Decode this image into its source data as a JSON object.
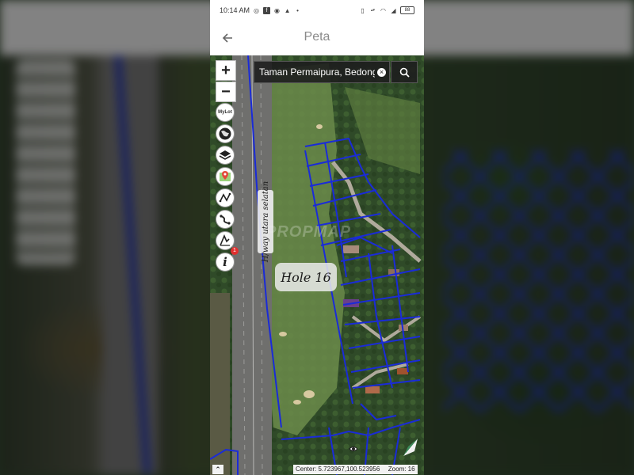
{
  "status_bar": {
    "time": "10:14 AM",
    "battery": "88",
    "icons": [
      "whatsapp-icon",
      "facebook-icon",
      "messenger-icon",
      "warning-icon",
      "dot-icon",
      "vibrate-icon",
      "data-speed-icon",
      "wifi-icon",
      "signal-icon",
      "battery-icon"
    ]
  },
  "app_bar": {
    "title": "Peta",
    "back_icon": "back-arrow-icon"
  },
  "map": {
    "search": {
      "value": "Taman Permaipura, Bedong",
      "placeholder": ""
    },
    "zoom_in_label": "+",
    "zoom_out_label": "−",
    "tools": [
      {
        "name": "mylot-button",
        "label": "MyLot"
      },
      {
        "name": "globe-button",
        "icon": "globe-icon"
      },
      {
        "name": "layers-button",
        "icon": "layers-icon"
      },
      {
        "name": "location-button",
        "icon": "map-pin-icon"
      },
      {
        "name": "measure-button",
        "icon": "measure-icon"
      },
      {
        "name": "route-button",
        "icon": "route-icon"
      },
      {
        "name": "draw-button",
        "icon": "pen-icon"
      },
      {
        "name": "info-button",
        "label": "i"
      }
    ],
    "info_badge": "1",
    "road_label": "H/way utara selatan",
    "hole_label": "Hole 16",
    "watermark": "PROPMAP",
    "center_label": "Center: 5.723967,100.523956",
    "zoom_label": "Zoom: 16",
    "collapse_icon": "caret-up-icon"
  },
  "colors": {
    "boundary": "#1a2bd8",
    "search_bg": "#1e1e1e",
    "badge": "#e03030"
  }
}
